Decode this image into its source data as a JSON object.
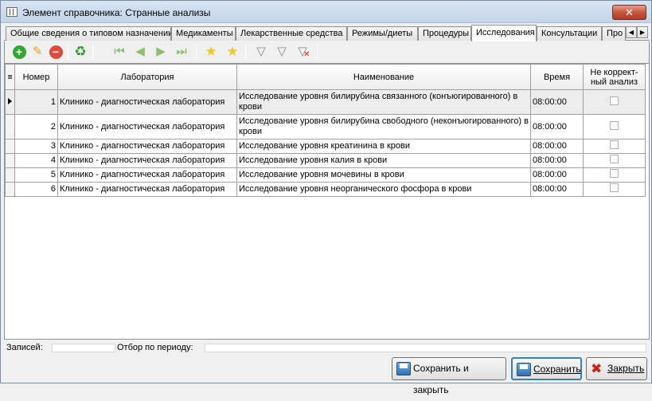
{
  "window": {
    "title": "Элемент справочника: Странные анализы",
    "close_glyph": "✕"
  },
  "tabs": [
    {
      "label": "Общие сведения о типовом назначении"
    },
    {
      "label": "Медикаменты"
    },
    {
      "label": "Лекарственные средства"
    },
    {
      "label": "Режимы/диеты"
    },
    {
      "label": "Процедуры"
    },
    {
      "label": "Исследования"
    },
    {
      "label": "Консультации"
    },
    {
      "label": "Про"
    }
  ],
  "active_tab": "Исследования",
  "toolbar_icons": [
    "add-icon",
    "edit-icon",
    "delete-icon",
    "refresh-icon",
    "first-icon",
    "prev-icon",
    "next-icon",
    "last-icon",
    "add-favorite-icon",
    "favorite-icon",
    "filter-icon",
    "filter-edit-icon",
    "filter-clear-icon"
  ],
  "table": {
    "columns": [
      "Номер",
      "Лаборатория",
      "Наименование",
      "Время",
      "Не коррект-ный анализ"
    ],
    "rows": [
      {
        "num": "1",
        "lab": "Клинико - диагностическая лаборатория",
        "name": "Исследование уровня билирубина связанного (конъюгированного) в крови",
        "time": "08:00:00",
        "incorrect": false
      },
      {
        "num": "2",
        "lab": "Клинико - диагностическая лаборатория",
        "name": "Исследование уровня билирубина свободного (неконъюгированного) в крови",
        "time": "08:00:00",
        "incorrect": false
      },
      {
        "num": "3",
        "lab": "Клинико - диагностическая лаборатория",
        "name": "Исследование уровня креатинина в крови",
        "time": "08:00:00",
        "incorrect": false
      },
      {
        "num": "4",
        "lab": "Клинико - диагностическая лаборатория",
        "name": "Исследование уровня калия в крови",
        "time": "08:00:00",
        "incorrect": false
      },
      {
        "num": "5",
        "lab": "Клинико - диагностическая лаборатория",
        "name": "Исследование уровня мочевины в крови",
        "time": "08:00:00",
        "incorrect": false
      },
      {
        "num": "6",
        "lab": "Клинико - диагностическая лаборатория",
        "name": "Исследование уровня неорганического фосфора в крови",
        "time": "08:00:00",
        "incorrect": false
      }
    ]
  },
  "status": {
    "records_label": "Записей:",
    "records_value": "",
    "period_label": "Отбор по периоду:",
    "period_value": ""
  },
  "buttons": {
    "save_close": "Сохранить и закрыть",
    "save": "Сохранить",
    "close": "Закрыть"
  },
  "colors": {
    "add": "#2ea82e",
    "delete": "#e04a3a",
    "nav": "#8cc06a",
    "star": "#f2c81e"
  }
}
